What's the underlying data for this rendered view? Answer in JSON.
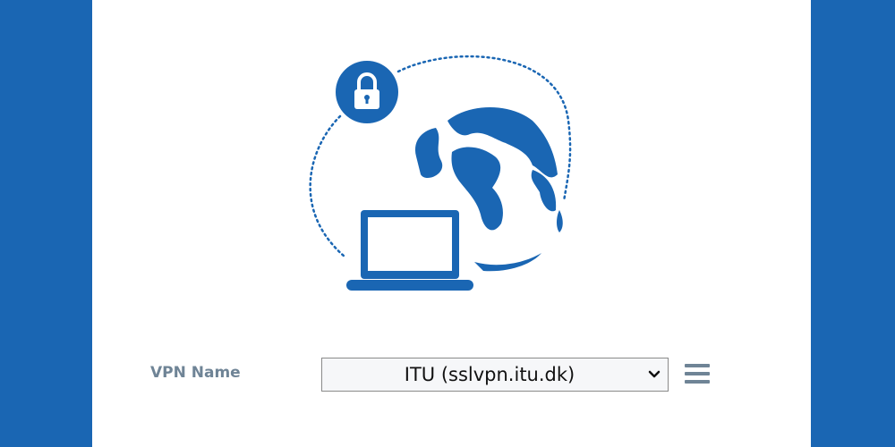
{
  "vpn": {
    "label": "VPN Name",
    "selected": "ITU (sslvpn.itu.dk)"
  },
  "icons": {
    "illustration": "vpn-illustration",
    "lock": "lock-icon",
    "globe": "globe-icon",
    "laptop": "laptop-icon",
    "chevron": "chevron-down-icon",
    "menu": "hamburger-menu-icon"
  },
  "colors": {
    "accent": "#1a66b3",
    "label": "#6f8496"
  }
}
